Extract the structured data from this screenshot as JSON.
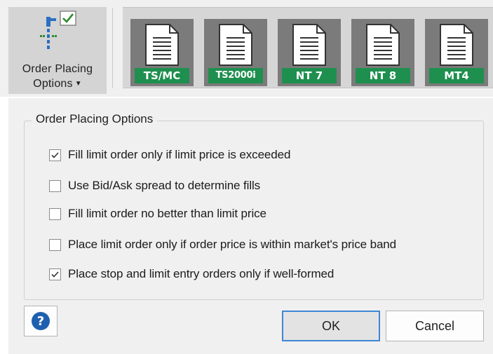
{
  "ribbon": {
    "order_placing_button": {
      "label_line1": "Order Placing",
      "label_line2": "Options",
      "icon": "order-placing-icon",
      "check_color": "#2e8b2e"
    },
    "platforms": [
      {
        "label": "TS/MC",
        "icon": "document-icon"
      },
      {
        "label": "TS2000i",
        "icon": "document-icon"
      },
      {
        "label": "NT 7",
        "icon": "document-icon"
      },
      {
        "label": "NT 8",
        "icon": "document-icon"
      },
      {
        "label": "MT4",
        "icon": "document-icon"
      }
    ],
    "accent_color": "#1e8f4e"
  },
  "group": {
    "title": "Order Placing Options",
    "options": [
      {
        "label": "Fill limit order only if limit price is exceeded",
        "checked": true
      },
      {
        "label": "Use Bid/Ask spread to determine fills",
        "checked": false
      },
      {
        "label": "Fill limit order no better than limit price",
        "checked": false
      },
      {
        "label": "Place limit order only if order price is within market's price band",
        "checked": false
      },
      {
        "label": "Place stop and limit entry orders only if well-formed",
        "checked": true
      }
    ]
  },
  "buttons": {
    "help_symbol": "?",
    "ok": "OK",
    "cancel": "Cancel"
  }
}
